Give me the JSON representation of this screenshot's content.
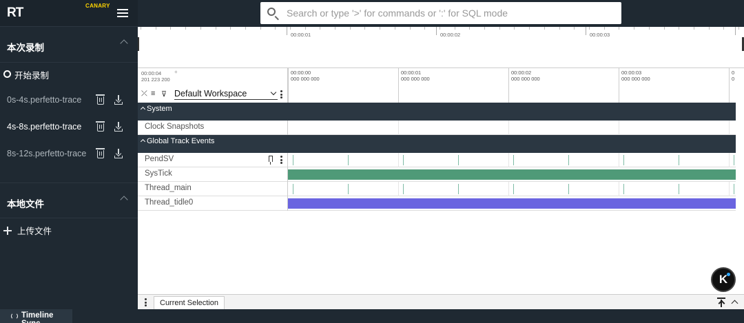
{
  "app": {
    "brand": "RT",
    "channel": "CANARY"
  },
  "sidebar": {
    "sections": [
      {
        "title": "本次录制",
        "items": [
          {
            "label": "开始录制",
            "icon": "record-circle-icon"
          },
          {
            "label": "0s-4s.perfetto-trace",
            "color": "#aeb6bc"
          },
          {
            "label": "4s-8s.perfetto-trace",
            "color": "#ffffff"
          },
          {
            "label": "8s-12s.perfetto-trace",
            "color": "#aeb6bc"
          }
        ]
      },
      {
        "title": "本地文件",
        "items": [
          {
            "label": "上传文件",
            "icon": "plus-icon"
          }
        ]
      }
    ]
  },
  "search": {
    "placeholder": "Search or type '>' for commands or ':' for SQL mode"
  },
  "overview": {
    "ticks": [
      "00:00:01",
      "00:00:02",
      "00:00:03"
    ]
  },
  "timeline": {
    "offset_time": "00:00:04",
    "offset_ns": "201 223 200",
    "offset_plus": "+",
    "workspace": "Default Workspace",
    "axis": [
      {
        "t": "00:00:00",
        "ns": "000 000 000"
      },
      {
        "t": "00:00:01",
        "ns": "000 000 000"
      },
      {
        "t": "00:00:02",
        "ns": "000 000 000"
      },
      {
        "t": "00:00:03",
        "ns": "000 000 000"
      },
      {
        "t": "0",
        "ns": "0"
      }
    ]
  },
  "tracks": {
    "group_system": "System",
    "clock_snapshots": "Clock Snapshots",
    "group_global": "Global Track Events",
    "pendsv": "PendSV",
    "systick": "SysTick",
    "thread_main": "Thread_main",
    "thread_idle": "Thread_tidle0"
  },
  "colors": {
    "systick": "#4f9a78",
    "thread_idle": "#6a64e0"
  },
  "bottom": {
    "tab": "Current Selection"
  },
  "status": {
    "timeline_sync": "Timeline Sync"
  },
  "badge": {
    "letter": "K"
  }
}
